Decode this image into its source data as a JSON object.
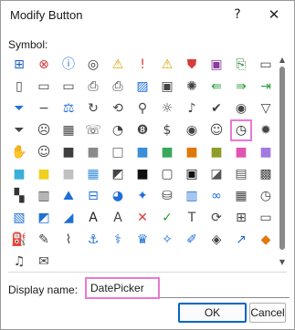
{
  "window": {
    "title": "Modify Button",
    "help_glyph": "?",
    "close_glyph": "✕"
  },
  "symbol_label": "Symbol:",
  "symbols": [
    {
      "name": "org-chart-icon",
      "g": "⊞",
      "c": "#1f5fbf"
    },
    {
      "name": "error-x-icon",
      "g": "⊗",
      "c": "#d83b3b"
    },
    {
      "name": "info-icon",
      "g": "ⓘ",
      "c": "#1f6fd6"
    },
    {
      "name": "target-icon",
      "g": "◎",
      "c": "#333333"
    },
    {
      "name": "warning-icon",
      "g": "⚠",
      "c": "#d9a400"
    },
    {
      "name": "exclamation-icon",
      "g": "!",
      "c": "#d83b3b"
    },
    {
      "name": "warning-small-icon",
      "g": "⚠",
      "c": "#d9a400"
    },
    {
      "name": "shield-icon",
      "g": "⛊",
      "c": "#d83b3b"
    },
    {
      "name": "save-icon",
      "g": "▣",
      "c": "#8a3b9e"
    },
    {
      "name": "page-arrow-icon",
      "g": "⎘",
      "c": "#2d7d3a"
    },
    {
      "name": "folder-icon",
      "g": "▭",
      "c": "#444444"
    },
    {
      "name": "document-icon",
      "g": "▯",
      "c": "#444444"
    },
    {
      "name": "folder-open-icon",
      "g": "▭",
      "c": "#444444"
    },
    {
      "name": "folder-doc-icon",
      "g": "▭",
      "c": "#444444"
    },
    {
      "name": "print-icon",
      "g": "⎙",
      "c": "#444444"
    },
    {
      "name": "print-preview-icon",
      "g": "⎙",
      "c": "#444444"
    },
    {
      "name": "picture-icon",
      "g": "▨",
      "c": "#1f6fd6"
    },
    {
      "name": "save-as-icon",
      "g": "▣",
      "c": "#444444"
    },
    {
      "name": "palette-icon",
      "g": "✺",
      "c": "#444444"
    },
    {
      "name": "back-arrow-icon",
      "g": "⇚",
      "c": "#2d9b3a"
    },
    {
      "name": "forward-arrow-icon",
      "g": "⇛",
      "c": "#2d9b3a"
    },
    {
      "name": "next-icon",
      "g": "⇥",
      "c": "#2d9b3a"
    },
    {
      "name": "filter-icon",
      "g": "⏷",
      "c": "#1f6fd6"
    },
    {
      "name": "minus-icon",
      "g": "−",
      "c": "#444444"
    },
    {
      "name": "scales-icon",
      "g": "⚖",
      "c": "#1f6fd6"
    },
    {
      "name": "refresh-icon",
      "g": "↻",
      "c": "#444444"
    },
    {
      "name": "circle-back-icon",
      "g": "⟲",
      "c": "#444444"
    },
    {
      "name": "pin-icon",
      "g": "⚲",
      "c": "#444444"
    },
    {
      "name": "lightbulb-icon",
      "g": "☼",
      "c": "#444444"
    },
    {
      "name": "sound-icon",
      "g": "♪",
      "c": "#444444"
    },
    {
      "name": "accept-icon",
      "g": "✔",
      "c": "#444444"
    },
    {
      "name": "view-icon",
      "g": "◉",
      "c": "#444444"
    },
    {
      "name": "filter-outline-icon",
      "g": "▽",
      "c": "#444444"
    },
    {
      "name": "filter-clear-icon",
      "g": "⏷",
      "c": "#444444"
    },
    {
      "name": "sad-face-icon",
      "g": "☹",
      "c": "#444444"
    },
    {
      "name": "calculator-icon",
      "g": "▦",
      "c": "#444444"
    },
    {
      "name": "phone-icon",
      "g": "☏",
      "c": "#444444"
    },
    {
      "name": "piggy-bank-icon",
      "g": "◔",
      "c": "#444444"
    },
    {
      "name": "number-eight-icon",
      "g": "❽",
      "c": "#444444"
    },
    {
      "name": "currency-icon",
      "g": "$",
      "c": "#444444"
    },
    {
      "name": "eye-icon",
      "g": "◉",
      "c": "#444444"
    },
    {
      "name": "person-icon",
      "g": "☺",
      "c": "#444444"
    },
    {
      "name": "clock-icon",
      "g": "◷",
      "c": "#222222",
      "sel": true
    },
    {
      "name": "virus-icon",
      "g": "✹",
      "c": "#444444"
    },
    {
      "name": "hand-icon",
      "g": "✋",
      "c": "#444444"
    },
    {
      "name": "smile-icon",
      "g": "☺",
      "c": "#444444"
    },
    {
      "name": "square-dark-icon",
      "g": "■",
      "c": "#3f3f3f"
    },
    {
      "name": "square-gray-icon",
      "g": "■",
      "c": "#8a8a8a"
    },
    {
      "name": "square-light-icon",
      "g": "□",
      "c": "#666666"
    },
    {
      "name": "square-blue-icon",
      "g": "■",
      "c": "#3a8fd8"
    },
    {
      "name": "square-green-icon",
      "g": "■",
      "c": "#3aa85a"
    },
    {
      "name": "square-orange-icon",
      "g": "■",
      "c": "#e0780a"
    },
    {
      "name": "square-olive-icon",
      "g": "■",
      "c": "#8f9e2a"
    },
    {
      "name": "square-pink-icon",
      "g": "■",
      "c": "#e055b0"
    },
    {
      "name": "square-purple-icon",
      "g": "■",
      "c": "#a37be0"
    },
    {
      "name": "square-cyan-icon",
      "g": "■",
      "c": "#3ab0d8"
    },
    {
      "name": "square-yellow-icon",
      "g": "■",
      "c": "#f0d020"
    },
    {
      "name": "square-lightgray-icon",
      "g": "■",
      "c": "#c0c0c0"
    },
    {
      "name": "grid-blue-icon",
      "g": "▦",
      "c": "#3a8fd8"
    },
    {
      "name": "triangle-icon",
      "g": "◩",
      "c": "#444444"
    },
    {
      "name": "square-black-icon",
      "g": "■",
      "c": "#111111"
    },
    {
      "name": "border-square-icon",
      "g": "▢",
      "c": "#444444"
    },
    {
      "name": "thick-border-icon",
      "g": "▣",
      "c": "#111111"
    },
    {
      "name": "half-square-icon",
      "g": "◪",
      "c": "#555555"
    },
    {
      "name": "gradient-square-icon",
      "g": "▤",
      "c": "#555555"
    },
    {
      "name": "checker-square-icon",
      "g": "▩",
      "c": "#444444"
    },
    {
      "name": "checkerboard-icon",
      "g": "▚",
      "c": "#333333"
    },
    {
      "name": "layers-icon",
      "g": "▥",
      "c": "#444444"
    },
    {
      "name": "mountain-icon",
      "g": "⛰",
      "c": "#1f6fd6"
    },
    {
      "name": "align-icon",
      "g": "⊟",
      "c": "#1f6fd6"
    },
    {
      "name": "pie-chart-icon",
      "g": "◕",
      "c": "#1f6fd6"
    },
    {
      "name": "radar-chart-icon",
      "g": "✦",
      "c": "#1f6fd6"
    },
    {
      "name": "database-icon",
      "g": "⛁",
      "c": "#444444"
    },
    {
      "name": "bar-chart-icon",
      "g": "▥",
      "c": "#1f6fd6"
    },
    {
      "name": "link-icon",
      "g": "∞",
      "c": "#1f6fd6"
    },
    {
      "name": "table-icon",
      "g": "▦",
      "c": "#444444"
    },
    {
      "name": "calendar-clock-icon",
      "g": "◷",
      "c": "#444444"
    },
    {
      "name": "chart-icon",
      "g": "▧",
      "c": "#1f6fd6"
    },
    {
      "name": "shape-fill-icon",
      "g": "◩",
      "c": "#1f6fd6"
    },
    {
      "name": "trend-icon",
      "g": "◢",
      "c": "#1f6fd6"
    },
    {
      "name": "text-box-icon",
      "g": "A",
      "c": "#222222"
    },
    {
      "name": "text-gray-icon",
      "g": "A",
      "c": "#444444"
    },
    {
      "name": "close-x-icon",
      "g": "✕",
      "c": "#d83b3b"
    },
    {
      "name": "checkmark-icon",
      "g": "✓",
      "c": "#2d9b3a"
    },
    {
      "name": "text-icon",
      "g": "T",
      "c": "#444444"
    },
    {
      "name": "cycle-icon",
      "g": "⟳",
      "c": "#444444"
    },
    {
      "name": "binary-icon",
      "g": "⊞",
      "c": "#444444"
    },
    {
      "name": "text-shape-icon",
      "g": "▭",
      "c": "#444444"
    },
    {
      "name": "fill-color-icon",
      "g": "⛽",
      "c": "#444444"
    },
    {
      "name": "pencil-icon",
      "g": "✎",
      "c": "#444444"
    },
    {
      "name": "brush-icon",
      "g": "⌇",
      "c": "#444444"
    },
    {
      "name": "anchor-icon",
      "g": "⚓",
      "c": "#1f6fd6"
    },
    {
      "name": "eyedropper-icon",
      "g": "⚕",
      "c": "#1f6fd6"
    },
    {
      "name": "trophy-icon",
      "g": "♛",
      "c": "#1f6fd6"
    },
    {
      "name": "sparkle-icon",
      "g": "✧",
      "c": "#1f6fd6"
    },
    {
      "name": "drawing-icon",
      "g": "✐",
      "c": "#1f6fd6"
    },
    {
      "name": "eraser-icon",
      "g": "◈",
      "c": "#444444"
    },
    {
      "name": "arrow-up-icon",
      "g": "↗",
      "c": "#1f6fd6"
    },
    {
      "name": "office-logo-icon",
      "g": "◆",
      "c": "#e0780a"
    },
    {
      "name": "bell-icon",
      "g": "♫",
      "c": "#444444"
    },
    {
      "name": "envelope-icon",
      "g": "✉",
      "c": "#444444"
    }
  ],
  "display_name_label": "Display name:",
  "display_name_value": "DatePicker",
  "buttons": {
    "ok": "OK",
    "cancel": "Cancel"
  }
}
